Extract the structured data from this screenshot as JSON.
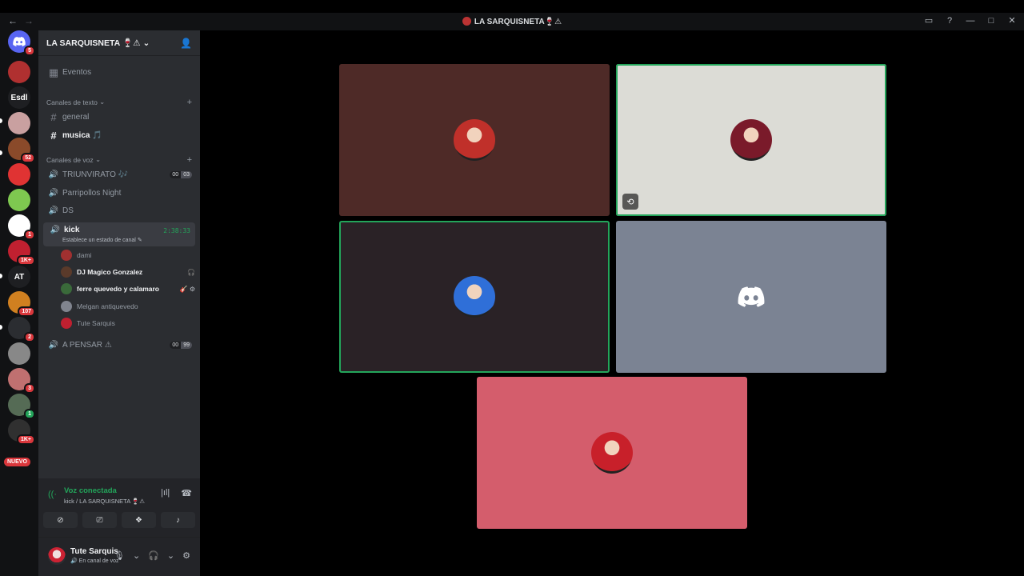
{
  "window": {
    "title": "LA SARQUISNETA",
    "title_emoji": "🍷⚠"
  },
  "rail": {
    "servers": [
      {
        "label": "",
        "color": "#5865f2",
        "badge": "5",
        "type": "discord-icon"
      },
      {
        "label": "",
        "color": "#b03030",
        "badge": ""
      },
      {
        "label": "Esdl",
        "color": "#1e1f22",
        "badge": ""
      },
      {
        "label": "",
        "color": "#c9a0a0",
        "badge": ""
      },
      {
        "label": "",
        "color": "#8a4a2a",
        "badge": "52"
      },
      {
        "label": "",
        "color": "#e03333",
        "badge": ""
      },
      {
        "label": "",
        "color": "#7ec850",
        "badge": ""
      },
      {
        "label": "",
        "color": "#ffffff",
        "badge": "1"
      },
      {
        "label": "",
        "color": "#c02030",
        "badge": "1K+"
      },
      {
        "label": "AT",
        "color": "#1e1f22",
        "badge": ""
      },
      {
        "label": "",
        "color": "#d08020",
        "badge": "107"
      },
      {
        "label": "",
        "color": "#2b2d31",
        "badge": "2"
      },
      {
        "label": "",
        "color": "#888888",
        "badge": ""
      },
      {
        "label": "",
        "color": "#c07070",
        "badge": "3"
      },
      {
        "label": "",
        "color": "#556b55",
        "badge": "1",
        "green": true
      },
      {
        "label": "",
        "color": "#303030",
        "badge": "1K+"
      }
    ],
    "nuevo_label": "NUEVO"
  },
  "sidebar": {
    "server_name": "LA SARQUISNETA",
    "server_emoji": "🍷⚠",
    "events_label": "Eventos",
    "text_category": "Canales de texto",
    "text_channels": [
      {
        "name": "general",
        "bright": false
      },
      {
        "name": "musica",
        "emoji": "🎵",
        "bright": true
      }
    ],
    "voice_category": "Canales de voz",
    "voice_channels": [
      {
        "name": "TRIUNVIRATO",
        "emoji": "🎶",
        "count_a": "00",
        "count_b": "03"
      },
      {
        "name": "Parripollos Night"
      },
      {
        "name": "DS"
      }
    ],
    "active_voice": {
      "name": "kick",
      "status": "Establece un estado de canal",
      "time": "2:38:33",
      "members": [
        {
          "name": "dami",
          "bright": false,
          "color": "#a03030"
        },
        {
          "name": "DJ Magico Gonzalez",
          "bright": true,
          "color": "#5a3a2a",
          "extra": "🎧"
        },
        {
          "name": "ferre quevedo y calamaro",
          "bright": true,
          "color": "#3a6a3a",
          "extra": "🎸 ⚙"
        },
        {
          "name": "Melgan antiquevedo",
          "bright": false,
          "color": "#80848e"
        },
        {
          "name": "Tute Sarquis",
          "bright": false,
          "color": "#c02030"
        }
      ]
    },
    "after_voice": {
      "name": "A PENSAR",
      "emoji": "⚠",
      "count_a": "00",
      "count_b": "99"
    }
  },
  "voice_panel": {
    "title": "Voz conectada",
    "subtitle": "kick / LA SARQUISNETA 🍷⚠"
  },
  "user_panel": {
    "name": "Tute Sarquis",
    "status": "En canal de voz"
  },
  "stage": {
    "tiles": [
      {
        "name": "tile-1",
        "bg": "#4e2a27",
        "speaking": false,
        "avatar": "#c0302a"
      },
      {
        "name": "tile-2",
        "bg": "#dcdcd6",
        "speaking": true,
        "avatar": "#7a1a2a",
        "screen_icon": true
      },
      {
        "name": "tile-3",
        "bg": "#2a2226",
        "speaking": true,
        "avatar": "#2f6fd8"
      },
      {
        "name": "tile-4",
        "bg": "#7b8393",
        "speaking": false,
        "discord": true
      },
      {
        "name": "tile-5",
        "bg": "#d45d6c",
        "speaking": false,
        "avatar": "#c8202a"
      }
    ]
  }
}
